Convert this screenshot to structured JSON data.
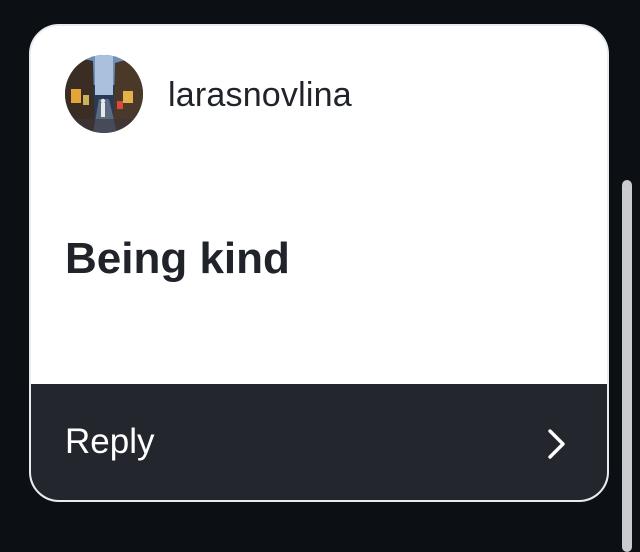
{
  "comment": {
    "username": "larasnovlina",
    "text": "Being kind",
    "reply_label": "Reply"
  },
  "icons": {
    "avatar": "street-photo-avatar",
    "reply_chevron": "chevron-right-icon"
  },
  "colors": {
    "background": "#0c0f14",
    "card": "#ffffff",
    "reply_bar": "#23262c",
    "text_dark": "#202329",
    "text_light": "#ffffff"
  }
}
